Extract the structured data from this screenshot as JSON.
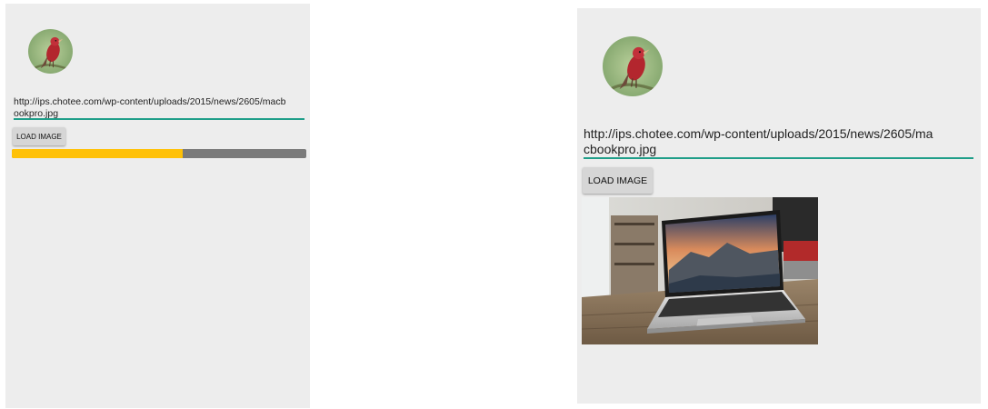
{
  "screens": [
    {
      "state": "loading",
      "avatar_icon": "red-bird-avatar-icon",
      "url_value": "http://ips.chotee.com/wp-content/uploads/2015/news/2605/macbookpro.jpg",
      "button_label": "LOAD IMAGE",
      "progress_fraction": 0.58
    },
    {
      "state": "loaded",
      "avatar_icon": "red-bird-avatar-icon",
      "url_value": "http://ips.chotee.com/wp-content/uploads/2015/news/2605/macbookpro.jpg",
      "button_label": "LOAD IMAGE",
      "loaded_image_icon": "macbook-laptop-photo"
    }
  ],
  "colors": {
    "screen_background": "#ededed",
    "underline_accent": "#1f9e89",
    "progress_fill": "#ffc107",
    "progress_track": "#7a7a7a",
    "button_background": "#d6d6d6"
  }
}
